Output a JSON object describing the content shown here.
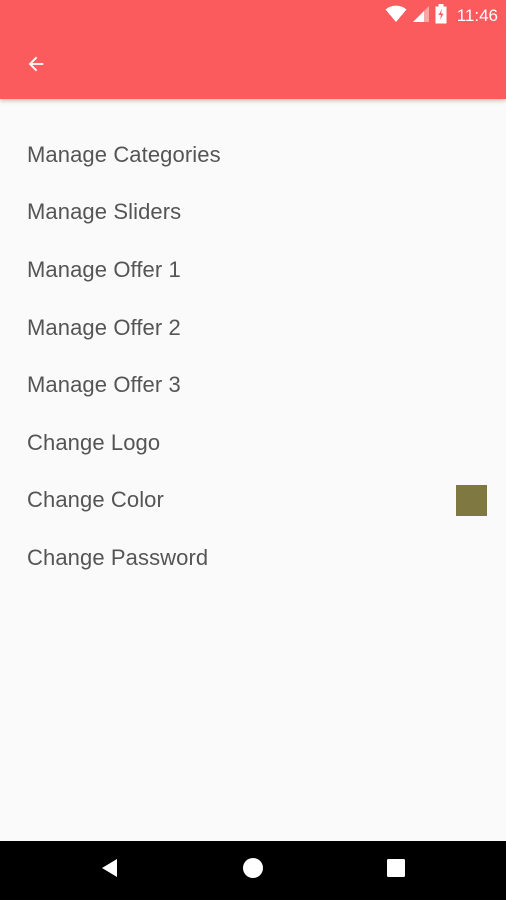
{
  "status_bar": {
    "time": "11:46",
    "icons": [
      "wifi-icon",
      "signal-icon",
      "battery-icon"
    ]
  },
  "app_bar": {
    "background_color": "#fc5b5d",
    "back_icon": "arrow-left-icon"
  },
  "menu": {
    "items": [
      {
        "label": "Manage Categories"
      },
      {
        "label": "Manage Sliders"
      },
      {
        "label": "Manage Offer 1"
      },
      {
        "label": "Manage Offer 2"
      },
      {
        "label": "Manage Offer 3"
      },
      {
        "label": "Change Logo"
      },
      {
        "label": "Change Color",
        "swatch_color": "#7f7840"
      },
      {
        "label": "Change Password"
      }
    ]
  },
  "nav_bar": {
    "buttons": [
      "back-triangle-icon",
      "home-circle-icon",
      "recents-square-icon"
    ]
  }
}
